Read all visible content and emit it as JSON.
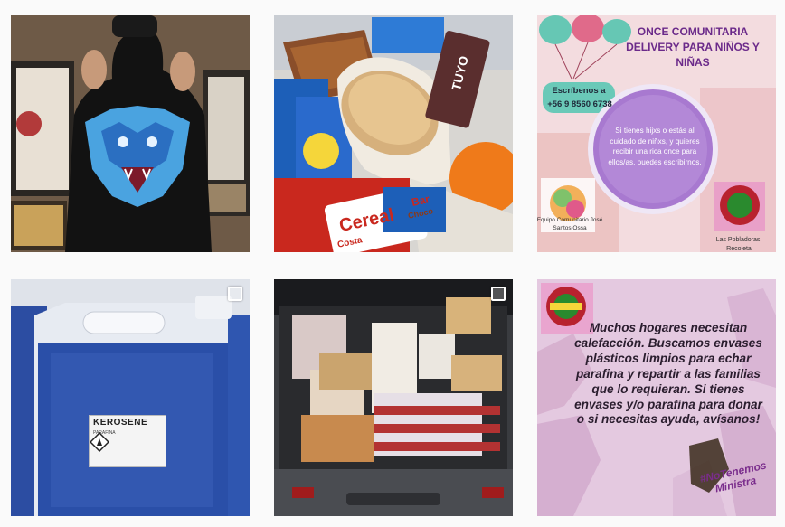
{
  "posts": [
    {
      "alt": "Person wearing black hoodie with blue wolf print"
    },
    {
      "alt": "Snack bag with sandwich, cereal bar and orange",
      "texts": {
        "cereal": "Cereal",
        "bar": "Bar",
        "costa": "Costa",
        "choco": "Choco",
        "tuyo": "TUYO"
      }
    },
    {
      "title": "ONCE COMUNITARIA DELIVERY PARA NIÑOS Y NIÑAS",
      "contact_label": "Escríbenos a",
      "phone": "+56 9 8560 6738",
      "circle_text": "Si tienes hijxs o estás al cuidado de niñxs, y quieres recibir una rica once para ellos/as, puedes escribirnos.",
      "left_caption": "Equipo Comunitario José Santos Ossa",
      "right_caption": "Las Pobladoras, Recoleta"
    },
    {
      "label_title": "KEROSENE",
      "label_sub": "PARAFINA",
      "multi": true
    },
    {
      "alt": "Car trunk full of groceries",
      "multi": true
    },
    {
      "body": "Muchos hogares necesitan calefacción. Buscamos envases plásticos limpios para echar parafina y repartir a las familias que lo requieran.  Si tienes envases y/o parafina para donar o si necesitas ayuda, avísanos!",
      "hashtag": "#NoTenemos Ministra"
    }
  ]
}
